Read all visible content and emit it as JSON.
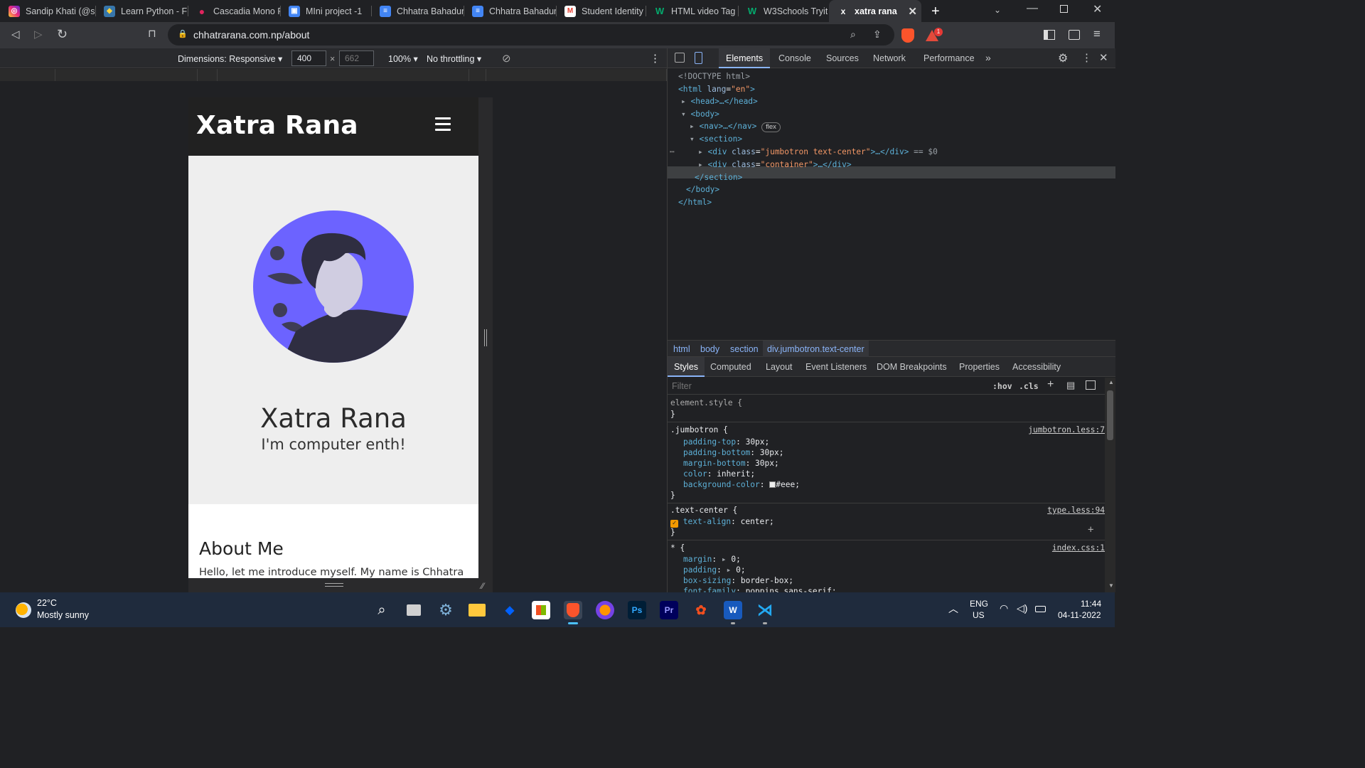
{
  "browser": {
    "tabs": [
      {
        "label": "Sandip Khati (@s",
        "icon": "instagram-icon",
        "color": "#e1306c"
      },
      {
        "label": "Learn Python - Fr",
        "icon": "python-icon",
        "color": "#3776ab"
      },
      {
        "label": "Cascadia Mono F",
        "icon": "record-icon",
        "color": "#e0245e"
      },
      {
        "label": "MIni project -1",
        "icon": "slides-icon",
        "color": "#4285f4"
      },
      {
        "label": "Chhatra Bahadur",
        "icon": "docs-icon",
        "color": "#4285f4"
      },
      {
        "label": "Chhatra Bahadur",
        "icon": "docs-icon",
        "color": "#4285f4"
      },
      {
        "label": "Student Identity",
        "icon": "gmail-icon",
        "color": "#ea4335"
      },
      {
        "label": "HTML video Tag",
        "icon": "w3schools-icon",
        "color": "#04aa6d"
      },
      {
        "label": "W3Schools Tryit",
        "icon": "w3schools-icon",
        "color": "#04aa6d"
      },
      {
        "label": "xatra rana",
        "icon": "site-icon",
        "color": "#ffffff"
      }
    ],
    "active_tab_index": 9,
    "url": "chhatrarana.com.np/about",
    "notification_count": "1"
  },
  "device_toolbar": {
    "dimensions_label": "Dimensions: Responsive",
    "width": "400",
    "height_placeholder": "662",
    "zoom": "100%",
    "throttling": "No throttling"
  },
  "mobile_page": {
    "brand": "Xatra Rana",
    "name": "Xatra Rana",
    "tagline": "I'm computer enth!",
    "about_heading": "About Me",
    "about_text": "Hello, let me introduce myself. My name is Chhatra",
    "avatar_color": "#6c63ff"
  },
  "devtools": {
    "tabs": [
      "Elements",
      "Console",
      "Sources",
      "Network",
      "Performance"
    ],
    "active_tab": "Elements",
    "dom": {
      "doctype": "<!DOCTYPE html>",
      "html_open": "<html",
      "html_attr": "lang",
      "html_val": "\"en\"",
      "head": "<head>…</head>",
      "body_open": "<body>",
      "nav": "<nav>…</nav>",
      "nav_badge": "flex",
      "section_open": "<section>",
      "div1_class": "\"jumbotron text-center\"",
      "div1_suffix": "== $0",
      "div2_class": "\"container\"",
      "section_close": "</section>",
      "body_close": "</body>",
      "html_close": "</html>"
    },
    "breadcrumb": [
      "html",
      "body",
      "section",
      "div.jumbotron.text-center"
    ],
    "style_tabs": [
      "Styles",
      "Computed",
      "Layout",
      "Event Listeners",
      "DOM Breakpoints",
      "Properties",
      "Accessibility"
    ],
    "filter_placeholder": "Filter",
    "hov": ":hov",
    "cls": ".cls",
    "rules": {
      "element_style": "element.style {",
      "close": "}",
      "jumbotron_selector": ".jumbotron {",
      "jumbotron_src": "jumbotron.less:7",
      "jumbotron_props": [
        {
          "name": "padding-top",
          "value": "30px;"
        },
        {
          "name": "padding-bottom",
          "value": "30px;"
        },
        {
          "name": "margin-bottom",
          "value": "30px;"
        },
        {
          "name": "color",
          "value": "inherit;"
        },
        {
          "name": "background-color",
          "value": "#eee;"
        }
      ],
      "textcenter_selector": ".text-center {",
      "textcenter_src": "type.less:94",
      "textcenter_prop": {
        "name": "text-align",
        "value": "center;"
      },
      "star_selector": "* {",
      "star_src": "index.css:1",
      "star_props": [
        {
          "name": "margin",
          "value": "0;"
        },
        {
          "name": "padding",
          "value": "0;"
        },
        {
          "name": "box-sizing",
          "value": "border-box;"
        },
        {
          "name": "font-family",
          "value": "poppins,sans-serif;"
        }
      ]
    }
  },
  "taskbar": {
    "weather_temp": "22°C",
    "weather_desc": "Mostly sunny",
    "lang": "ENG",
    "region": "US",
    "time": "11:44",
    "date": "04-11-2022"
  }
}
